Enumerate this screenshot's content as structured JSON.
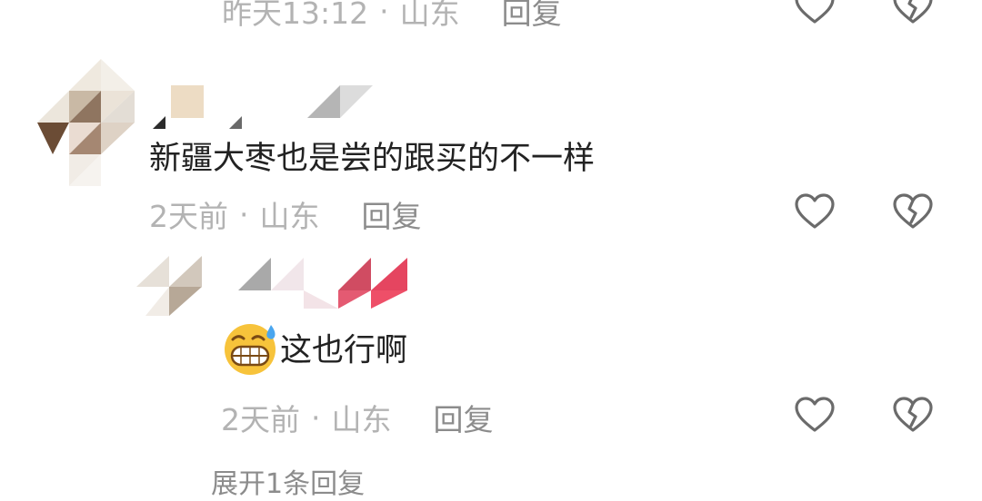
{
  "top_item": {
    "time": "昨天13:12",
    "location": "山东",
    "reply_label": "回复"
  },
  "comment": {
    "text": "新疆大枣也是尝的跟买的不一样",
    "time": "2天前",
    "location": "山东",
    "reply_label": "回复"
  },
  "sub_reply": {
    "text": "这也行啊",
    "emoji": "grinning-sweat-emoji",
    "time": "2天前",
    "location": "山东",
    "reply_label": "回复"
  },
  "more_replies_label": "展开1条回复",
  "separator": "·",
  "icons": {
    "like": "heart-icon",
    "dislike": "broken-heart-icon"
  },
  "colors": {
    "meta_text": "#b3b3b3",
    "reply_text": "#8c8c8c",
    "icon_stroke": "#6b6b6b",
    "body_text": "#222222"
  }
}
